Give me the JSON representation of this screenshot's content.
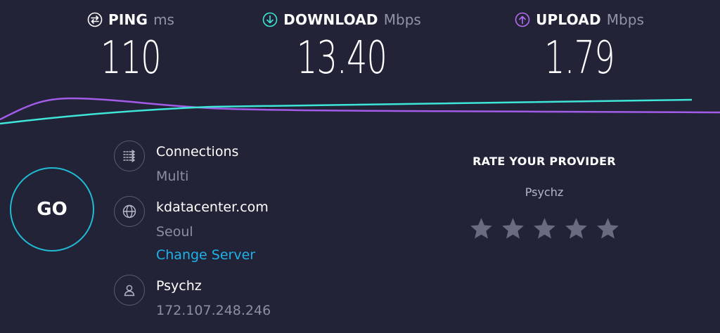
{
  "metrics": {
    "ping": {
      "name": "PING",
      "unit": "ms",
      "value": "110",
      "icon": "ping-icon"
    },
    "download": {
      "name": "DOWNLOAD",
      "unit": "Mbps",
      "value": "13.40",
      "icon": "download-arrow-icon"
    },
    "upload": {
      "name": "UPLOAD",
      "unit": "Mbps",
      "value": "1.79",
      "icon": "upload-arrow-icon"
    }
  },
  "go_button": {
    "label": "GO"
  },
  "connections": {
    "title": "Connections",
    "value": "Multi",
    "icon": "connections-icon"
  },
  "server": {
    "host": "kdatacenter.com",
    "location": "Seoul",
    "change_label": "Change Server",
    "icon": "globe-icon"
  },
  "provider": {
    "name": "Psychz",
    "ip": "172.107.248.246",
    "icon": "user-icon"
  },
  "rate": {
    "title": "RATE YOUR PROVIDER",
    "isp": "Psychz",
    "stars_total": 5,
    "stars_selected": 0
  },
  "colors": {
    "background": "#232338",
    "download_accent": "#3ee6d8",
    "upload_accent": "#a25ce8",
    "go_ring": "#1fbcd4",
    "link": "#1fb2e8",
    "muted": "#8c8ea3",
    "star": "#6a6b80"
  }
}
